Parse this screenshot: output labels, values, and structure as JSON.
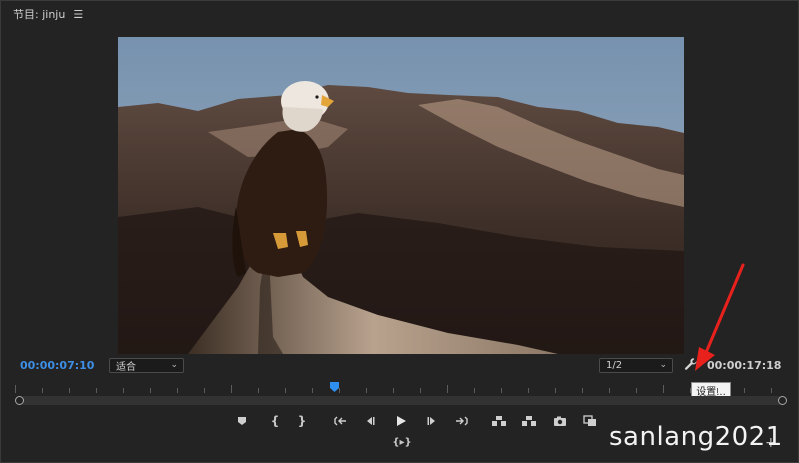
{
  "panel": {
    "title": "节目: jinju",
    "menu_icon": "hamburger-menu-icon"
  },
  "monitor": {
    "current_timecode": "00:00:07:10",
    "total_timecode": "00:00:17:18",
    "zoom": {
      "selected": "适合",
      "options_visible": [
        "适合"
      ]
    },
    "resolution": {
      "selected": "1/2"
    },
    "settings_tooltip": "设置...",
    "playhead_fraction": 0.41
  },
  "transport": {
    "icons": [
      "add-marker-icon",
      "mark-in-icon",
      "mark-out-icon",
      "go-to-in-icon",
      "step-back-icon",
      "play-icon",
      "step-forward-icon",
      "go-to-out-icon",
      "lift-icon",
      "extract-icon",
      "export-frame-icon",
      "comparison-view-icon",
      "insert-clip-icon",
      "add-button-icon"
    ]
  },
  "colors": {
    "timecode_accent": "#3d8ee4",
    "panel_bg": "#232323",
    "annotation_arrow": "#e8211d"
  },
  "watermark": "sanlang2021"
}
